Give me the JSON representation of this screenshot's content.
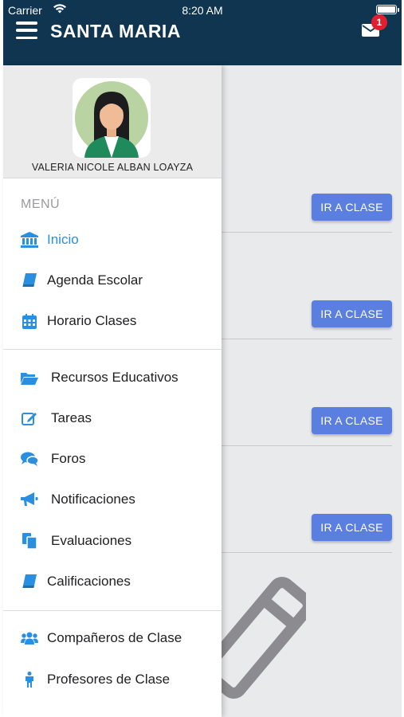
{
  "status_bar": {
    "carrier": "Carrier",
    "time": "8:20 AM"
  },
  "header": {
    "title": "SANTA MARIA",
    "notification_count": "1"
  },
  "profile": {
    "name": "VALERIA NICOLE ALBAN LOAYZA"
  },
  "menu": {
    "heading": "MENÚ",
    "items": [
      {
        "label": "Inicio",
        "icon": "bank-icon",
        "active": true
      },
      {
        "label": "Agenda Escolar",
        "icon": "book-icon"
      },
      {
        "label": "Horario Clases",
        "icon": "calendar-icon"
      },
      {
        "label": "Recursos Educativos",
        "icon": "folder-open-icon"
      },
      {
        "label": "Tareas",
        "icon": "edit-icon"
      },
      {
        "label": "Foros",
        "icon": "comments-icon"
      },
      {
        "label": "Notificaciones",
        "icon": "megaphone-icon"
      },
      {
        "label": "Evaluaciones",
        "icon": "documents-icon"
      },
      {
        "label": "Calificaciones",
        "icon": "book-icon"
      },
      {
        "label": "Compañeros de Clase",
        "icon": "users-icon"
      },
      {
        "label": "Profesores de Clase",
        "icon": "person-icon"
      }
    ]
  },
  "classes": {
    "button_label": "IR A CLASE"
  },
  "colors": {
    "header_bg": "#0f3550",
    "accent": "#2a8fe0",
    "button": "#5b7fe0",
    "badge": "#e02030"
  }
}
